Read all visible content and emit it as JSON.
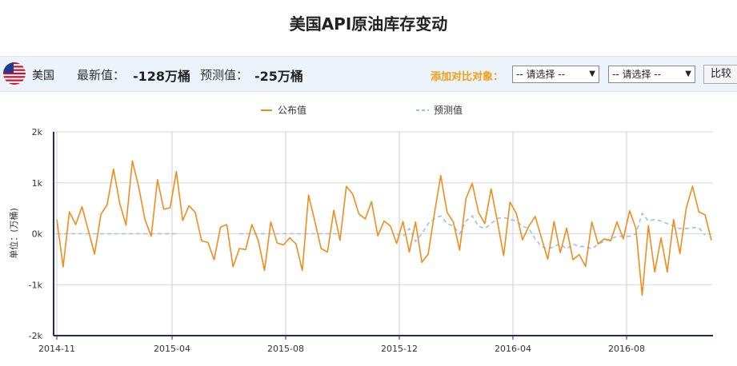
{
  "title": "美国API原油库存变动",
  "header": {
    "country": "美国",
    "latest_label": "最新值：",
    "latest_value": "-128万桶",
    "forecast_label": "预测值：",
    "forecast_value": "-25万桶",
    "add_compare_label": "添加对比对象：",
    "select1": "-- 请选择 --",
    "select2": "-- 请选择 --",
    "compare_button": "比较"
  },
  "colors": {
    "actual": "#f08c1e",
    "forecast": "#9bc0e6",
    "axis": "#1f2d5a"
  },
  "chart_data": {
    "type": "line",
    "title": "",
    "ylabel": "单位：(万桶)",
    "ylim": [
      -2000,
      2000
    ],
    "y_ticks": [
      "2k",
      "1k",
      "0k",
      "-1k",
      "-2k"
    ],
    "x_ticks": [
      "2014-11",
      "2015-04",
      "2015-08",
      "2015-12",
      "2016-04",
      "2016-08"
    ],
    "legend": {
      "position": "top-center"
    },
    "grid": true,
    "series": [
      {
        "name": "公布值",
        "values": [
          280,
          -650,
          430,
          180,
          530,
          70,
          -400,
          380,
          570,
          1270,
          590,
          170,
          1430,
          920,
          280,
          -50,
          1060,
          480,
          510,
          1220,
          260,
          550,
          420,
          -140,
          -170,
          -510,
          130,
          180,
          -650,
          -290,
          -310,
          180,
          -130,
          -720,
          230,
          -180,
          -220,
          -80,
          -200,
          -720,
          760,
          240,
          -290,
          -360,
          460,
          -130,
          930,
          780,
          390,
          290,
          630,
          -40,
          250,
          150,
          -190,
          240,
          -360,
          230,
          -560,
          -400,
          400,
          1140,
          420,
          230,
          -320,
          690,
          990,
          420,
          200,
          880,
          240,
          -430,
          620,
          400,
          -120,
          150,
          340,
          -80,
          -500,
          240,
          -370,
          110,
          -510,
          -410,
          -640,
          230,
          -200,
          -100,
          -140,
          230,
          -100,
          450,
          110,
          -1210,
          160,
          -750,
          -80,
          -750,
          280,
          -390,
          500,
          930,
          430,
          370,
          -128
        ]
      },
      {
        "name": "预测值",
        "values": [
          0,
          0,
          0,
          0,
          0,
          0,
          0,
          0,
          0,
          0,
          0,
          0,
          0,
          0,
          0,
          0,
          0,
          0,
          0,
          0,
          null,
          null,
          null,
          null,
          null,
          null,
          null,
          null,
          null,
          0,
          0,
          0,
          0,
          0,
          0,
          0,
          0,
          0,
          0,
          0,
          0,
          0,
          0,
          0,
          0,
          0,
          null,
          null,
          null,
          null,
          null,
          null,
          null,
          null,
          0,
          -50,
          100,
          -150,
          0,
          200,
          300,
          350,
          200,
          150,
          0,
          250,
          350,
          150,
          100,
          200,
          300,
          320,
          280,
          250,
          150,
          100,
          -100,
          -250,
          -300,
          -250,
          -200,
          -300,
          -200,
          -250,
          -250,
          -300,
          -200,
          -150,
          -100,
          -50,
          -50,
          -50,
          0,
          400,
          250,
          280,
          250,
          200,
          150,
          100,
          100,
          120,
          120,
          -25
        ]
      }
    ]
  }
}
